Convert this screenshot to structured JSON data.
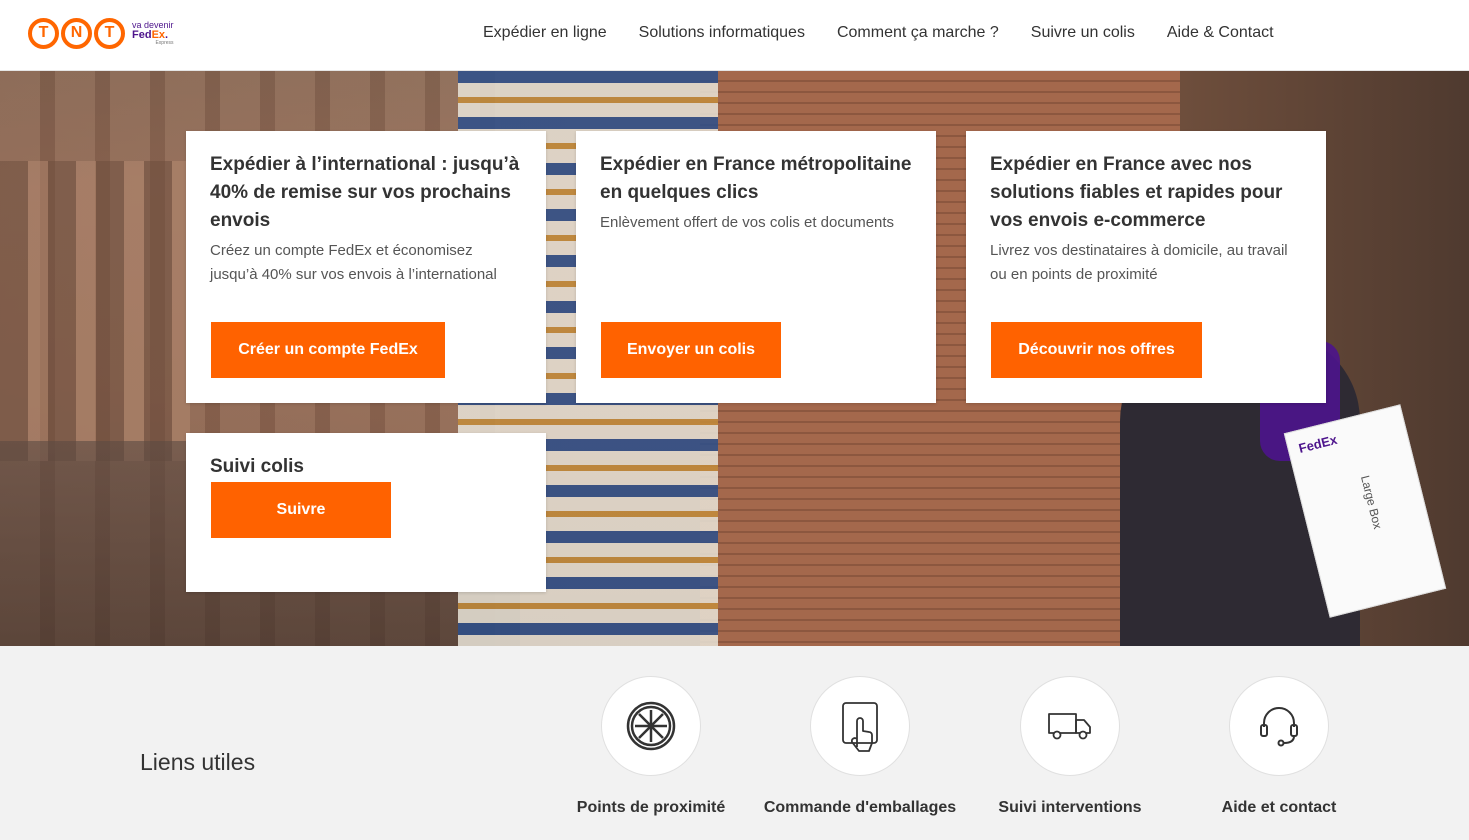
{
  "header": {
    "logo": {
      "brand": "TNT",
      "tagline": "va devenir",
      "partner": "FedEx",
      "partner_sub": "Express"
    },
    "nav": [
      {
        "label": "Expédier en ligne"
      },
      {
        "label": "Solutions informatiques"
      },
      {
        "label": "Comment ça marche ?"
      },
      {
        "label": "Suivre un colis"
      },
      {
        "label": "Aide & Contact"
      }
    ]
  },
  "hero": {
    "box_label": "Large Box",
    "box_brand": "FedEx"
  },
  "cards": [
    {
      "title": "Expédier à l’international : jusqu’à 40% de remise sur vos prochains envois",
      "text": "Créez un compte FedEx et économisez jusqu’à 40% sur vos envois à l’international",
      "button": "Créer un compte FedEx"
    },
    {
      "title": "Expédier en France métropolitaine en quelques clics",
      "text": "Enlèvement offert de vos colis et documents",
      "button": "Envoyer un colis"
    },
    {
      "title": "Expédier en France avec nos solutions fiables et rapides pour vos envois e-commerce",
      "text": "Livrez vos destinataires à domicile, au travail ou en points de proximité",
      "button": "Découvrir nos offres"
    },
    {
      "title": "Suivi colis",
      "button": "Suivre"
    }
  ],
  "useful_links": {
    "heading": "Liens utiles",
    "items": [
      {
        "label": "Points de proximité",
        "icon": "globe-icon"
      },
      {
        "label": "Commande d'emballages",
        "icon": "touch-tablet-icon"
      },
      {
        "label": "Suivi interventions",
        "icon": "truck-icon"
      },
      {
        "label": "Aide et contact",
        "icon": "headset-icon"
      }
    ]
  },
  "colors": {
    "accent": "#ff6200",
    "tnt_orange": "#ff6600",
    "fedex_purple": "#4d148c",
    "bottom_bg": "#f2f2f2"
  }
}
